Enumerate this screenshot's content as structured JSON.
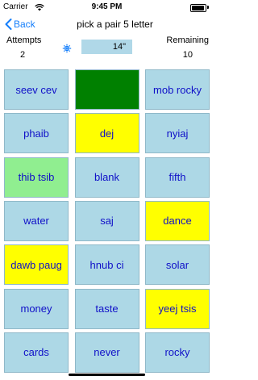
{
  "status": {
    "carrier": "Carrier",
    "time": "9:45 PM"
  },
  "nav": {
    "back_label": "Back",
    "title": "pick a pair 5 letter"
  },
  "stats": {
    "attempts_label": "Attempts",
    "attempts_value": "2",
    "remaining_label": "Remaining",
    "remaining_value": "10",
    "timer": "14\""
  },
  "colors": {
    "card_default": "#add8e6",
    "card_selected": "#ffff00",
    "card_matched": "#90ee90",
    "card_hidden": "#008000",
    "card_text": "#1010c8",
    "accent": "#147efb"
  },
  "cards": [
    {
      "label": "seev cev",
      "state": "default"
    },
    {
      "label": "",
      "state": "hidden"
    },
    {
      "label": "mob rocky",
      "state": "default"
    },
    {
      "label": "phaib",
      "state": "default"
    },
    {
      "label": "dej",
      "state": "selected"
    },
    {
      "label": "nyiaj",
      "state": "default"
    },
    {
      "label": "thib tsib",
      "state": "matched"
    },
    {
      "label": "blank",
      "state": "default"
    },
    {
      "label": "fifth",
      "state": "default"
    },
    {
      "label": "water",
      "state": "default"
    },
    {
      "label": "saj",
      "state": "default"
    },
    {
      "label": "dance",
      "state": "selected"
    },
    {
      "label": "dawb paug",
      "state": "selected"
    },
    {
      "label": "hnub ci",
      "state": "default"
    },
    {
      "label": "solar",
      "state": "default"
    },
    {
      "label": "money",
      "state": "default"
    },
    {
      "label": "taste",
      "state": "default"
    },
    {
      "label": "yeej tsis",
      "state": "selected"
    },
    {
      "label": "cards",
      "state": "default"
    },
    {
      "label": "never",
      "state": "default"
    },
    {
      "label": "rocky",
      "state": "default"
    }
  ]
}
